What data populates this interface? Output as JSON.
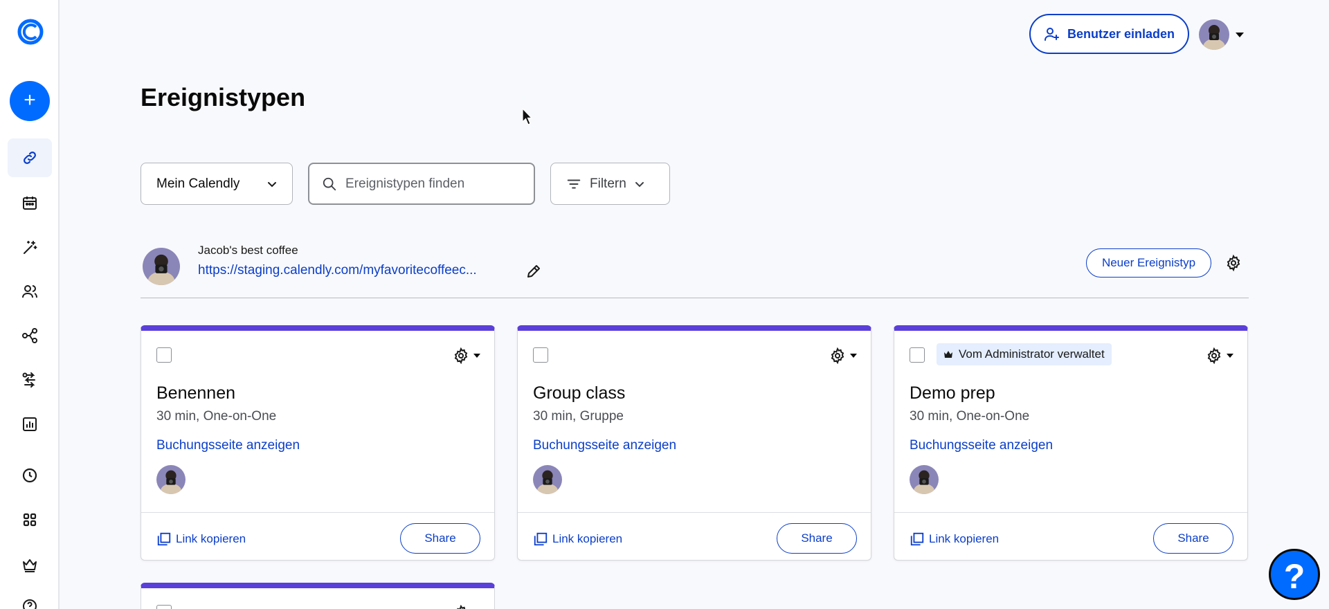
{
  "sidebar": {
    "logo_icon": "calendly-logo-icon",
    "create_icon": "plus-icon",
    "create_symbol": "+",
    "nav_items": [
      {
        "icon": "link-icon",
        "active": true
      },
      {
        "icon": "calendar-icon",
        "active": false
      },
      {
        "icon": "magic-wand-icon",
        "active": false
      },
      {
        "icon": "contacts-icon",
        "active": false
      },
      {
        "icon": "workflow-icon",
        "active": false
      },
      {
        "icon": "routing-icon",
        "active": false
      },
      {
        "icon": "analytics-icon",
        "active": false
      },
      {
        "icon": "availability-icon",
        "active": false
      },
      {
        "icon": "apps-grid-icon",
        "active": false
      },
      {
        "icon": "crown-icon",
        "active": false
      },
      {
        "icon": "help-circle-icon",
        "active": false
      }
    ]
  },
  "header": {
    "invite_label": "Benutzer einladen"
  },
  "page": {
    "title": "Ereignistypen"
  },
  "toolbar": {
    "calendly_select": "Mein Calendly",
    "search_placeholder": "Ereignistypen finden",
    "filter_label": "Filtern"
  },
  "user": {
    "name": "Jacob's best coffee",
    "link": "https://staging.calendly.com/myfavoritecoffeec...",
    "new_type_label": "Neuer Ereignistyp"
  },
  "cards": [
    {
      "title": "Benennen",
      "meta": "30 min, One-on-One",
      "booking": "Buchungsseite anzeigen",
      "copy": "Link kopieren",
      "share": "Share",
      "admin": false
    },
    {
      "title": "Group class",
      "meta": "30 min, Gruppe",
      "booking": "Buchungsseite anzeigen",
      "copy": "Link kopieren",
      "share": "Share",
      "admin": false
    },
    {
      "title": "Demo prep",
      "meta": "30 min, One-on-One",
      "booking": "Buchungsseite anzeigen",
      "copy": "Link kopieren",
      "share": "Share",
      "admin": true,
      "admin_label": "Vom Administrator verwaltet"
    }
  ],
  "colors": {
    "accent": "#006bff",
    "link": "#0b3ec9",
    "card_top": "#5b3fd9"
  },
  "help": {
    "label": "?"
  }
}
